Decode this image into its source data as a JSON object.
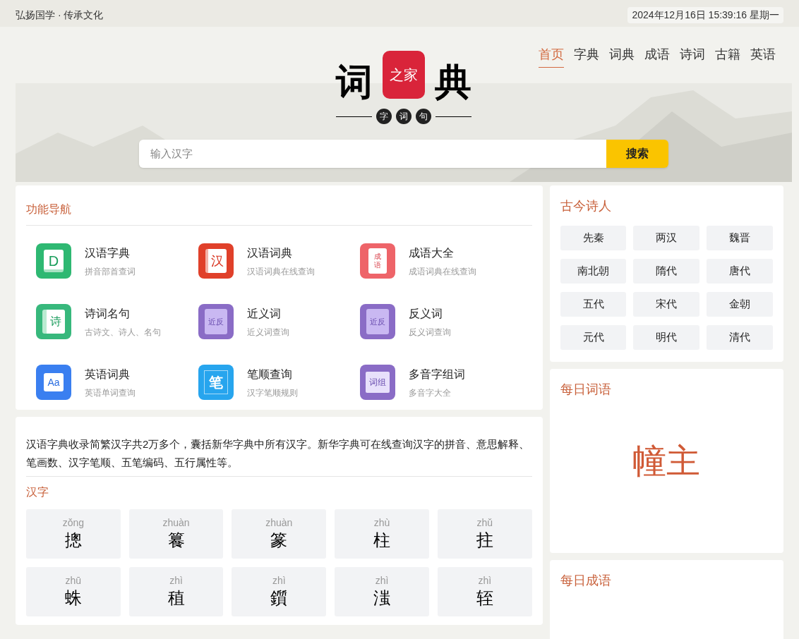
{
  "top_bar": {
    "slogan": "弘扬国学 · 传承文化",
    "datetime": "2024年12月16日 15:39:16 星期一"
  },
  "logo": {
    "left": "词",
    "seal": "之家",
    "right": "典",
    "badges": [
      "字",
      "词",
      "句"
    ]
  },
  "nav": [
    {
      "label": "首页",
      "selected": true
    },
    {
      "label": "字典",
      "selected": false
    },
    {
      "label": "词典",
      "selected": false
    },
    {
      "label": "成语",
      "selected": false
    },
    {
      "label": "诗词",
      "selected": false
    },
    {
      "label": "古籍",
      "selected": false
    },
    {
      "label": "英语",
      "selected": false
    }
  ],
  "search": {
    "placeholder": "输入汉字",
    "button": "搜索"
  },
  "features": {
    "title": "功能导航",
    "items": [
      {
        "kind": "zidian",
        "title": "汉语字典",
        "subtitle": "拼音部首查词",
        "icon_text": "D",
        "color": "#2eb872"
      },
      {
        "kind": "cidian",
        "title": "汉语词典",
        "subtitle": "汉语词典在线查询",
        "icon_text": "汉",
        "color": "#e0402a"
      },
      {
        "kind": "chengyu",
        "title": "成语大全",
        "subtitle": "成语词典在线查询",
        "icon_text": "成语",
        "color": "#ee6469"
      },
      {
        "kind": "shici",
        "title": "诗词名句",
        "subtitle": "古诗文、诗人、名句",
        "icon_text": "诗",
        "color": "#37b87c"
      },
      {
        "kind": "jinfan",
        "title": "近义词",
        "subtitle": "近义词查询",
        "icon_text": "近反",
        "color": "#8a6cc6"
      },
      {
        "kind": "jinfan",
        "title": "反义词",
        "subtitle": "反义词查询",
        "icon_text": "近反",
        "color": "#8a6cc6"
      },
      {
        "kind": "english",
        "title": "英语词典",
        "subtitle": "英语单词查询",
        "icon_text": "Aa",
        "color": "#3a7ff0"
      },
      {
        "kind": "bishun",
        "title": "笔顺查询",
        "subtitle": "汉字笔顺规则",
        "icon_text": "笔",
        "color": "#27a5ee"
      },
      {
        "kind": "duoyin",
        "title": "多音字组词",
        "subtitle": "多音字大全",
        "icon_text": "词组",
        "color": "#8a6cc6"
      }
    ]
  },
  "hanzi_section": {
    "intro": "汉语字典收录简繁汉字共2万多个，囊括新华字典中所有汉字。新华字典可在线查询汉字的拼音、意思解释、笔画数、汉字笔顺、五笔编码、五行属性等。",
    "title": "汉字",
    "chars": [
      {
        "pinyin": "zǒng",
        "char": "摠"
      },
      {
        "pinyin": "zhuàn",
        "char": "籑"
      },
      {
        "pinyin": "zhuàn",
        "char": "篆"
      },
      {
        "pinyin": "zhù",
        "char": "柱"
      },
      {
        "pinyin": "zhǔ",
        "char": "拄"
      },
      {
        "pinyin": "zhū",
        "char": "蛛"
      },
      {
        "pinyin": "zhì",
        "char": "稙"
      },
      {
        "pinyin": "zhì",
        "char": "鑕"
      },
      {
        "pinyin": "zhì",
        "char": "滍"
      },
      {
        "pinyin": "zhì",
        "char": "轾"
      }
    ]
  },
  "poets": {
    "title": "古今诗人",
    "eras": [
      "先秦",
      "两汉",
      "魏晋",
      "南北朝",
      "隋代",
      "唐代",
      "五代",
      "宋代",
      "金朝",
      "元代",
      "明代",
      "清代"
    ]
  },
  "daily_word": {
    "title": "每日词语",
    "word": "幢主"
  },
  "daily_idiom": {
    "title": "每日成语"
  }
}
